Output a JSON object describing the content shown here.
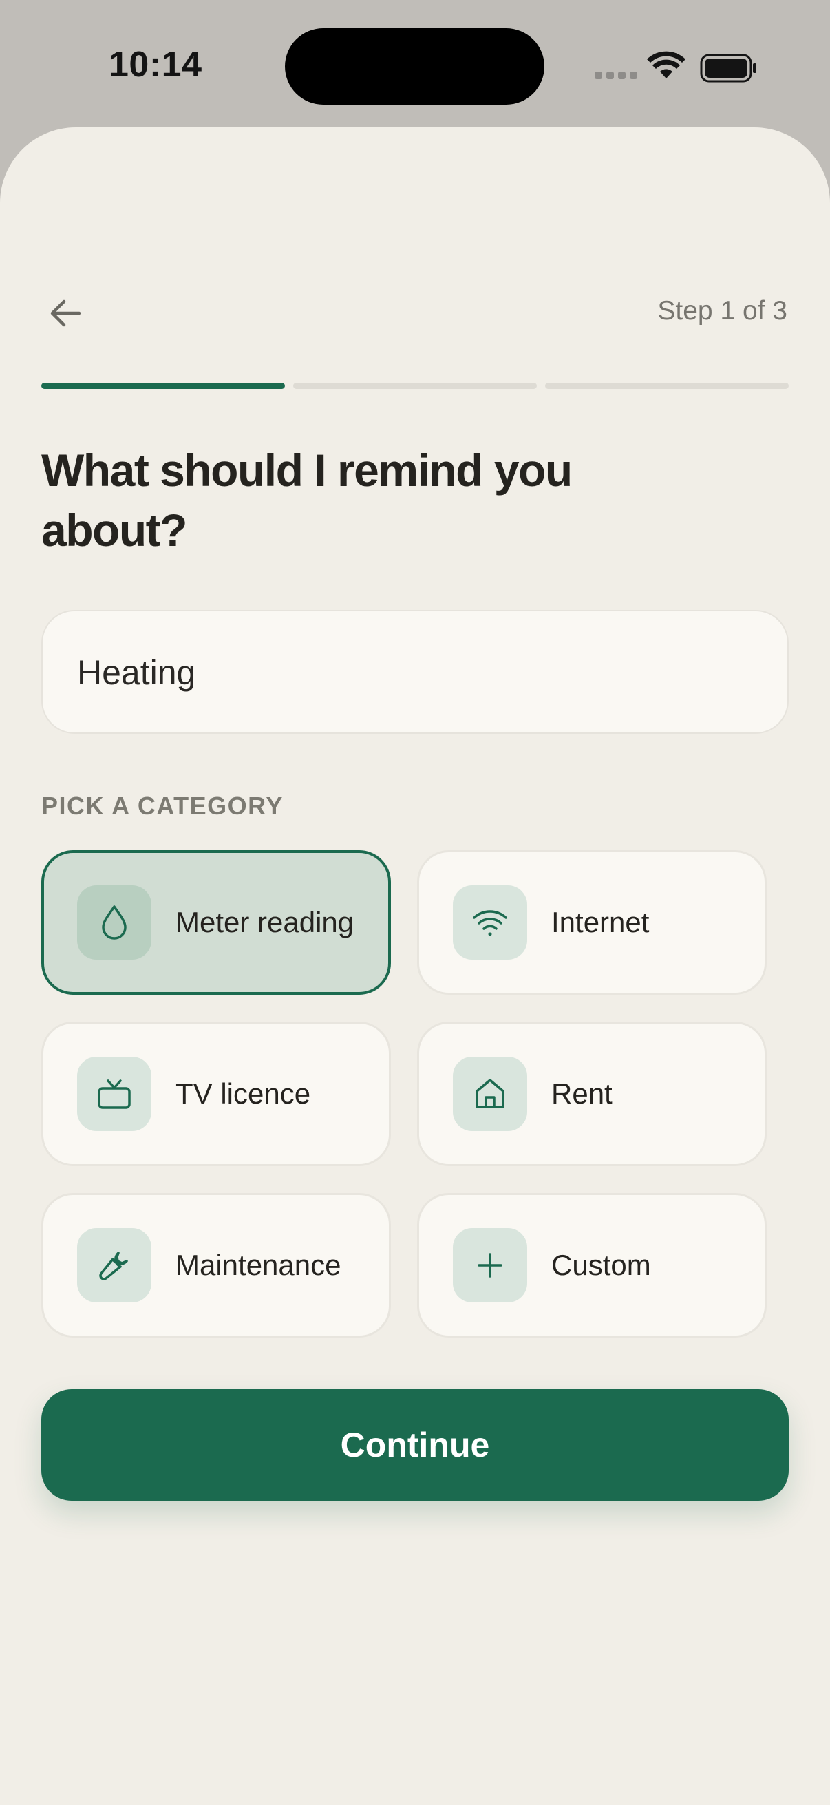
{
  "status_bar": {
    "time": "10:14"
  },
  "header": {
    "step_text": "Step 1 of 3",
    "total_steps": 3,
    "current_step": 1
  },
  "title": "What should I remind you about?",
  "reminder_input": {
    "value": "Heating"
  },
  "category_section": {
    "label": "PICK A CATEGORY",
    "selected": "Meter reading",
    "categories": [
      {
        "label": "Meter reading",
        "icon": "droplet-icon",
        "selected": true
      },
      {
        "label": "Internet",
        "icon": "wifi-icon",
        "selected": false
      },
      {
        "label": "TV licence",
        "icon": "tv-icon",
        "selected": false
      },
      {
        "label": "Rent",
        "icon": "home-icon",
        "selected": false
      },
      {
        "label": "Maintenance",
        "icon": "wrench-icon",
        "selected": false
      },
      {
        "label": "Custom",
        "icon": "plus-icon",
        "selected": false
      }
    ]
  },
  "continue_label": "Continue",
  "colors": {
    "accent": "#1B6A4F",
    "background": "#F1EEE7",
    "selected_card": "#D1DDD3"
  }
}
